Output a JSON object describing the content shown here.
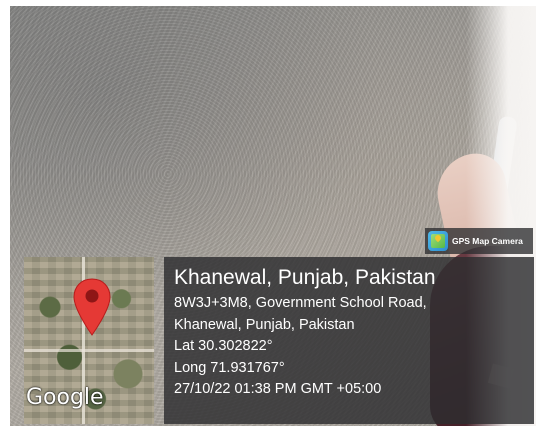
{
  "gps_badge": {
    "icon": "gps-map-camera-icon",
    "label": "GPS Map Camera"
  },
  "map": {
    "pin_icon": "map-pin-icon",
    "pin_color": "#e53935",
    "logo": "Google"
  },
  "location": {
    "title": "Khanewal, Punjab, Pakistan",
    "address_line_1": "8W3J+3M8, Government School Road,",
    "address_line_2": "Khanewal, Punjab, Pakistan",
    "latitude": "Lat 30.302822°",
    "longitude": "Long 71.931767°",
    "timestamp": "27/10/22 01:38 PM GMT +05:00"
  },
  "colors": {
    "overlay": "#2d2d30",
    "text": "#ffffff"
  }
}
